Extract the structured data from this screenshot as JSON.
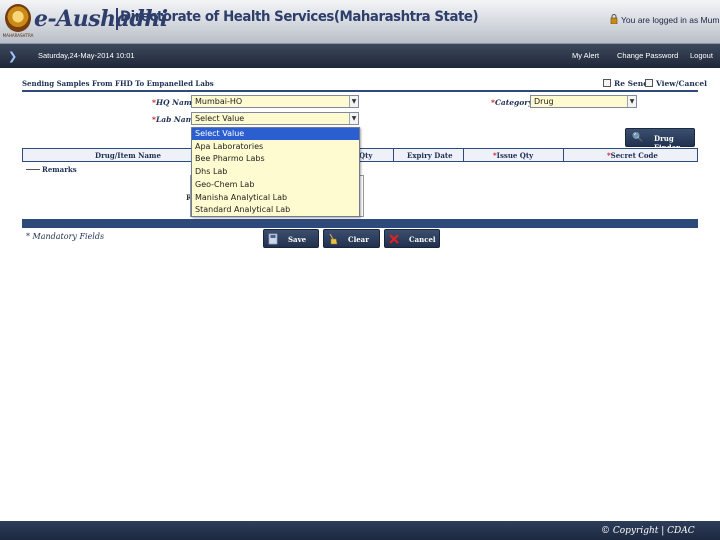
{
  "header": {
    "brand": "e-Aushadhi",
    "directorate": "Directorate of Health Services(Maharashtra State)",
    "logged_in_text": "You are logged in as Mumbai Hu",
    "logo_caption": "MAHARASHTRA"
  },
  "navbar": {
    "datetime": "Saturday,24-May-2014 10:01",
    "links": [
      "My Alert",
      "Change Password",
      "Logout"
    ]
  },
  "form": {
    "title": "Sending Samples From FHD To Empanelled Labs",
    "resend_label": "Re Send",
    "view_cancel_label": "View/Cancel",
    "hq_name_label": "HQ Name",
    "hq_name_value": "Mumbai-HO",
    "lab_name_label": "Lab Name",
    "lab_name_value": "Select Value",
    "category_label": "Category",
    "category_value": "Drug",
    "required_mark": "*",
    "drug_finder_label": "Drug Finder",
    "remarks_label": "Remarks",
    "remarks_r": "R",
    "mandatory_note": "* Mandatory Fields"
  },
  "table": {
    "columns": [
      "Drug/Item Name",
      "Qty",
      "Expiry Date",
      "Issue Qty",
      "Secret Code"
    ]
  },
  "lab_dropdown": {
    "options": [
      "Select Value",
      "Apa Laboratories",
      "Bee Pharmo Labs",
      "Dhs Lab",
      "Geo-Chem Lab",
      "Manisha Analytical Lab",
      "Standard Analytical Lab"
    ],
    "selected_index": 0
  },
  "buttons": {
    "save": "Save",
    "clear": "Clear",
    "cancel": "Cancel"
  },
  "footer": {
    "copyright": "© Copyright | CDAC"
  }
}
